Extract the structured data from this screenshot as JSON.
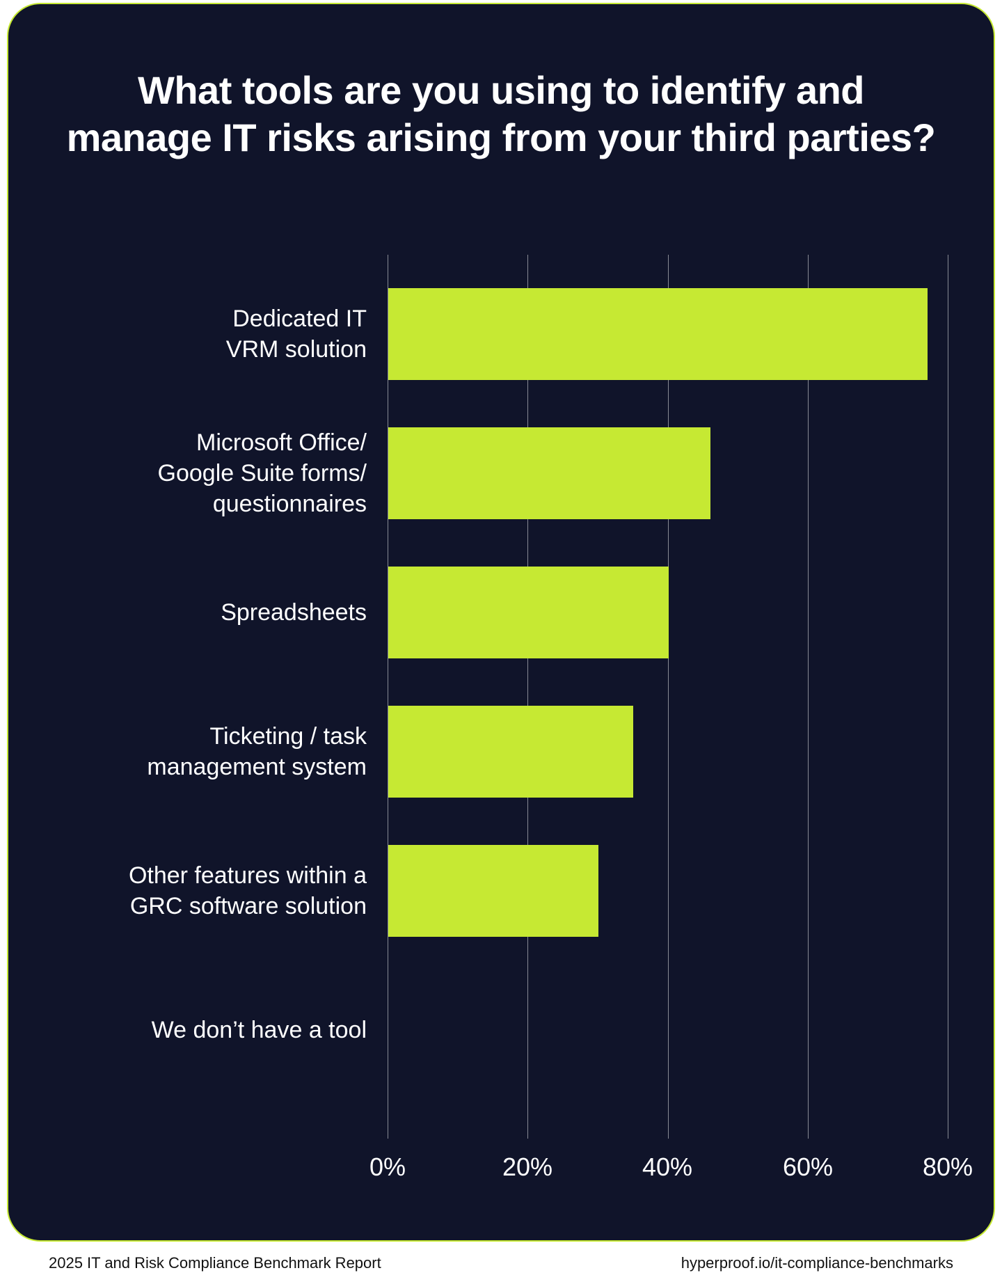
{
  "chart_data": {
    "type": "bar",
    "orientation": "horizontal",
    "title": "What tools are you using to identify and manage IT risks arising from your third parties?",
    "categories": [
      "Dedicated IT\nVRM solution",
      "Microsoft Office/\nGoogle Suite forms/\nquestionnaires",
      "Spreadsheets",
      "Ticketing / task\nmanagement system",
      "Other features within a\nGRC software solution",
      "We don’t have a tool"
    ],
    "values": [
      77,
      46,
      40,
      35,
      30,
      0
    ],
    "xlabel": "",
    "ylabel": "",
    "x_ticks": [
      0,
      20,
      40,
      60,
      80
    ],
    "x_tick_labels": [
      "0%",
      "20%",
      "40%",
      "60%",
      "80%"
    ],
    "xlim": [
      0,
      80
    ],
    "bar_color": "#C6E933",
    "grid": true
  },
  "footer": {
    "left": "2025 IT and Risk Compliance Benchmark Report",
    "right": "hyperproof.io/it-compliance-benchmarks"
  }
}
